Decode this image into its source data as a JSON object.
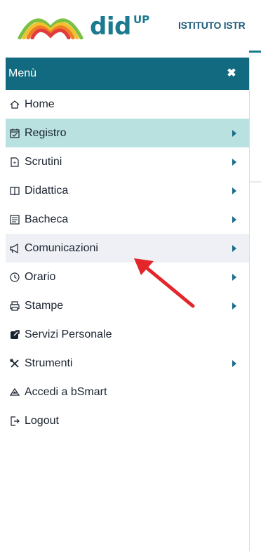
{
  "header": {
    "brand": "did",
    "brand_sup": "UP",
    "school": "ISTITUTO ISTR"
  },
  "menu": {
    "title": "Menù",
    "close_glyph": "✖",
    "items": [
      {
        "label": "Home",
        "icon": "home-icon",
        "submenu": false,
        "state": "normal"
      },
      {
        "label": "Registro",
        "icon": "calendar-icon",
        "submenu": true,
        "state": "active"
      },
      {
        "label": "Scrutini",
        "icon": "report-card-icon",
        "submenu": true,
        "state": "normal"
      },
      {
        "label": "Didattica",
        "icon": "book-icon",
        "submenu": true,
        "state": "normal"
      },
      {
        "label": "Bacheca",
        "icon": "bulletin-board-icon",
        "submenu": true,
        "state": "normal"
      },
      {
        "label": "Comunicazioni",
        "icon": "megaphone-icon",
        "submenu": true,
        "state": "hover"
      },
      {
        "label": "Orario",
        "icon": "clock-icon",
        "submenu": true,
        "state": "normal"
      },
      {
        "label": "Stampe",
        "icon": "printer-icon",
        "submenu": true,
        "state": "normal"
      },
      {
        "label": "Servizi Personale",
        "icon": "external-link-icon",
        "submenu": false,
        "state": "normal"
      },
      {
        "label": "Strumenti",
        "icon": "tools-icon",
        "submenu": true,
        "state": "normal"
      },
      {
        "label": "Accedi a bSmart",
        "icon": "bsmart-icon",
        "submenu": false,
        "state": "normal"
      },
      {
        "label": "Logout",
        "icon": "logout-icon",
        "submenu": false,
        "state": "normal"
      }
    ]
  },
  "colors": {
    "menu_header": "#116a7f",
    "active_item": "#b8e1df",
    "hover_item": "#eef0f5",
    "caret": "#1b6d8c",
    "annotation_arrow": "#e3262b"
  }
}
